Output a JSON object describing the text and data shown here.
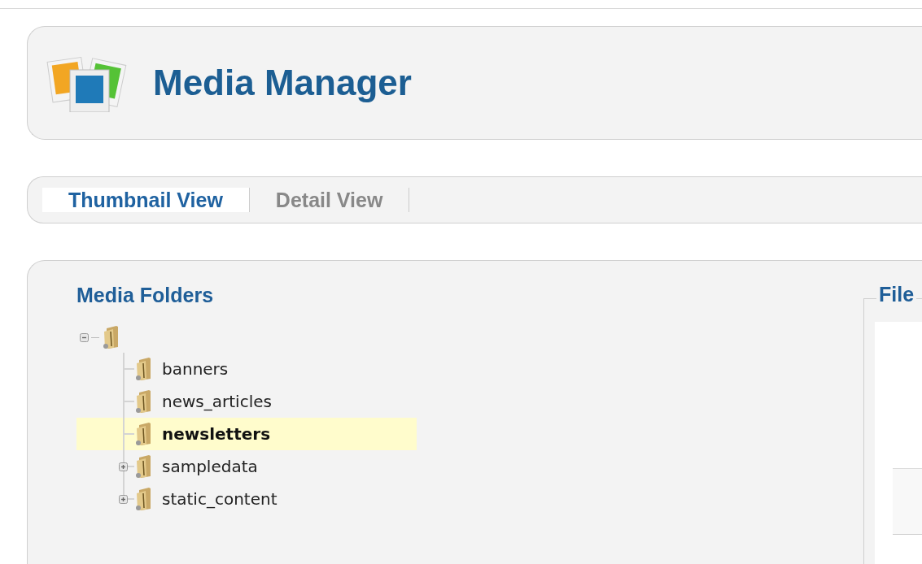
{
  "header": {
    "title": "Media Manager"
  },
  "tabs": [
    {
      "label": "Thumbnail View",
      "selected": true
    },
    {
      "label": "Detail View",
      "selected": false
    }
  ],
  "folders": {
    "title": "Media Folders",
    "root": {
      "expanded": true,
      "children": [
        {
          "name": "banners",
          "selected": false
        },
        {
          "name": "news_articles",
          "selected": false
        },
        {
          "name": "newsletters",
          "selected": true
        },
        {
          "name": "sampledata",
          "selected": false,
          "expanded": false
        },
        {
          "name": "static_content",
          "selected": false,
          "expanded": false
        }
      ]
    }
  },
  "files": {
    "title": "File"
  }
}
